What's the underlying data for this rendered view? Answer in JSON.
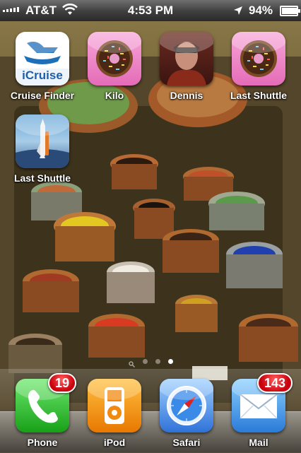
{
  "status_bar": {
    "carrier": "AT&T",
    "time": "4:53 PM",
    "battery_percent": "94%",
    "battery_level": 0.94,
    "icons": [
      "signal-bars-icon",
      "wifi-icon",
      "location-arrow-icon",
      "battery-icon"
    ]
  },
  "home_apps": [
    {
      "label": "Cruise Finder",
      "icon_text": "iCruise",
      "icon": "icruise-icon"
    },
    {
      "label": "Kilo",
      "icon": "donut-icon"
    },
    {
      "label": "Dennis",
      "icon": "portrait-icon"
    },
    {
      "label": "Last Shuttle",
      "icon": "donut-icon"
    },
    {
      "label": "Last Shuttle",
      "icon": "space-shuttle-icon"
    }
  ],
  "page_indicator": {
    "pages": 3,
    "current": 3,
    "has_search_page": true
  },
  "dock": [
    {
      "label": "Phone",
      "badge": "19",
      "icon": "phone-icon",
      "color": "#2fbf2f"
    },
    {
      "label": "iPod",
      "badge": "",
      "icon": "ipod-icon",
      "color": "#f08a10"
    },
    {
      "label": "Safari",
      "badge": "",
      "icon": "safari-compass-icon",
      "color": "#3f88e8"
    },
    {
      "label": "Mail",
      "badge": "143",
      "icon": "mail-envelope-icon",
      "color": "#4a9ee8"
    }
  ]
}
